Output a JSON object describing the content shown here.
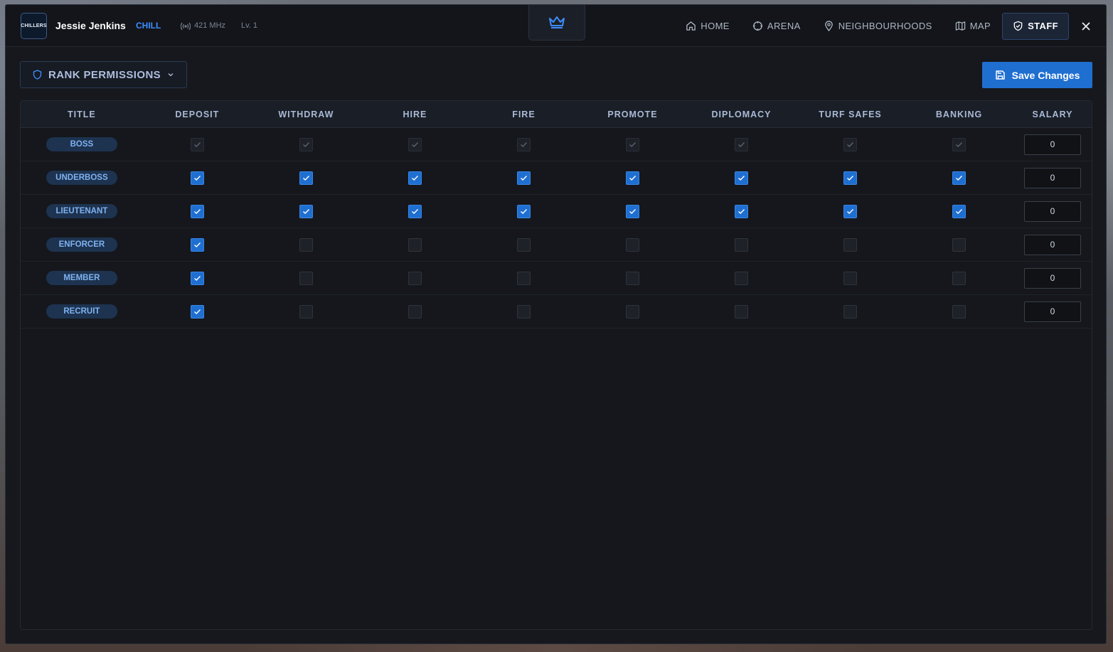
{
  "header": {
    "logo_text": "CHILLERS",
    "player_name": "Jessie Jenkins",
    "player_tag": "CHILL",
    "radio_frequency": "421 MHz",
    "level": "Lv. 1",
    "nav": [
      {
        "label": "HOME",
        "icon": "home-icon"
      },
      {
        "label": "ARENA",
        "icon": "crosshair-icon"
      },
      {
        "label": "NEIGHBOURHOODS",
        "icon": "map-pin-icon"
      },
      {
        "label": "MAP",
        "icon": "map-icon"
      },
      {
        "label": "STAFF",
        "icon": "shield-icon",
        "active": true
      }
    ],
    "close_icon": "close-icon"
  },
  "toolbar": {
    "dropdown_label": "RANK PERMISSIONS",
    "save_label": "Save Changes"
  },
  "table": {
    "columns": [
      "TITLE",
      "DEPOSIT",
      "WITHDRAW",
      "HIRE",
      "FIRE",
      "PROMOTE",
      "DIPLOMACY",
      "TURF SAFES",
      "BANKING",
      "SALARY"
    ],
    "rows": [
      {
        "title": "BOSS",
        "perms": [
          true,
          true,
          true,
          true,
          true,
          true,
          true,
          true
        ],
        "disabled": true,
        "salary": "0"
      },
      {
        "title": "UNDERBOSS",
        "perms": [
          true,
          true,
          true,
          true,
          true,
          true,
          true,
          true
        ],
        "disabled": false,
        "salary": "0"
      },
      {
        "title": "LIEUTENANT",
        "perms": [
          true,
          true,
          true,
          true,
          true,
          true,
          true,
          true
        ],
        "disabled": false,
        "salary": "0"
      },
      {
        "title": "ENFORCER",
        "perms": [
          true,
          false,
          false,
          false,
          false,
          false,
          false,
          false
        ],
        "disabled": false,
        "salary": "0"
      },
      {
        "title": "MEMBER",
        "perms": [
          true,
          false,
          false,
          false,
          false,
          false,
          false,
          false
        ],
        "disabled": false,
        "salary": "0"
      },
      {
        "title": "RECRUIT",
        "perms": [
          true,
          false,
          false,
          false,
          false,
          false,
          false,
          false
        ],
        "disabled": false,
        "salary": "0"
      }
    ]
  },
  "colors": {
    "accent": "#1f6fd1",
    "tag": "#3d8dff",
    "window_bg": "#16181d"
  }
}
